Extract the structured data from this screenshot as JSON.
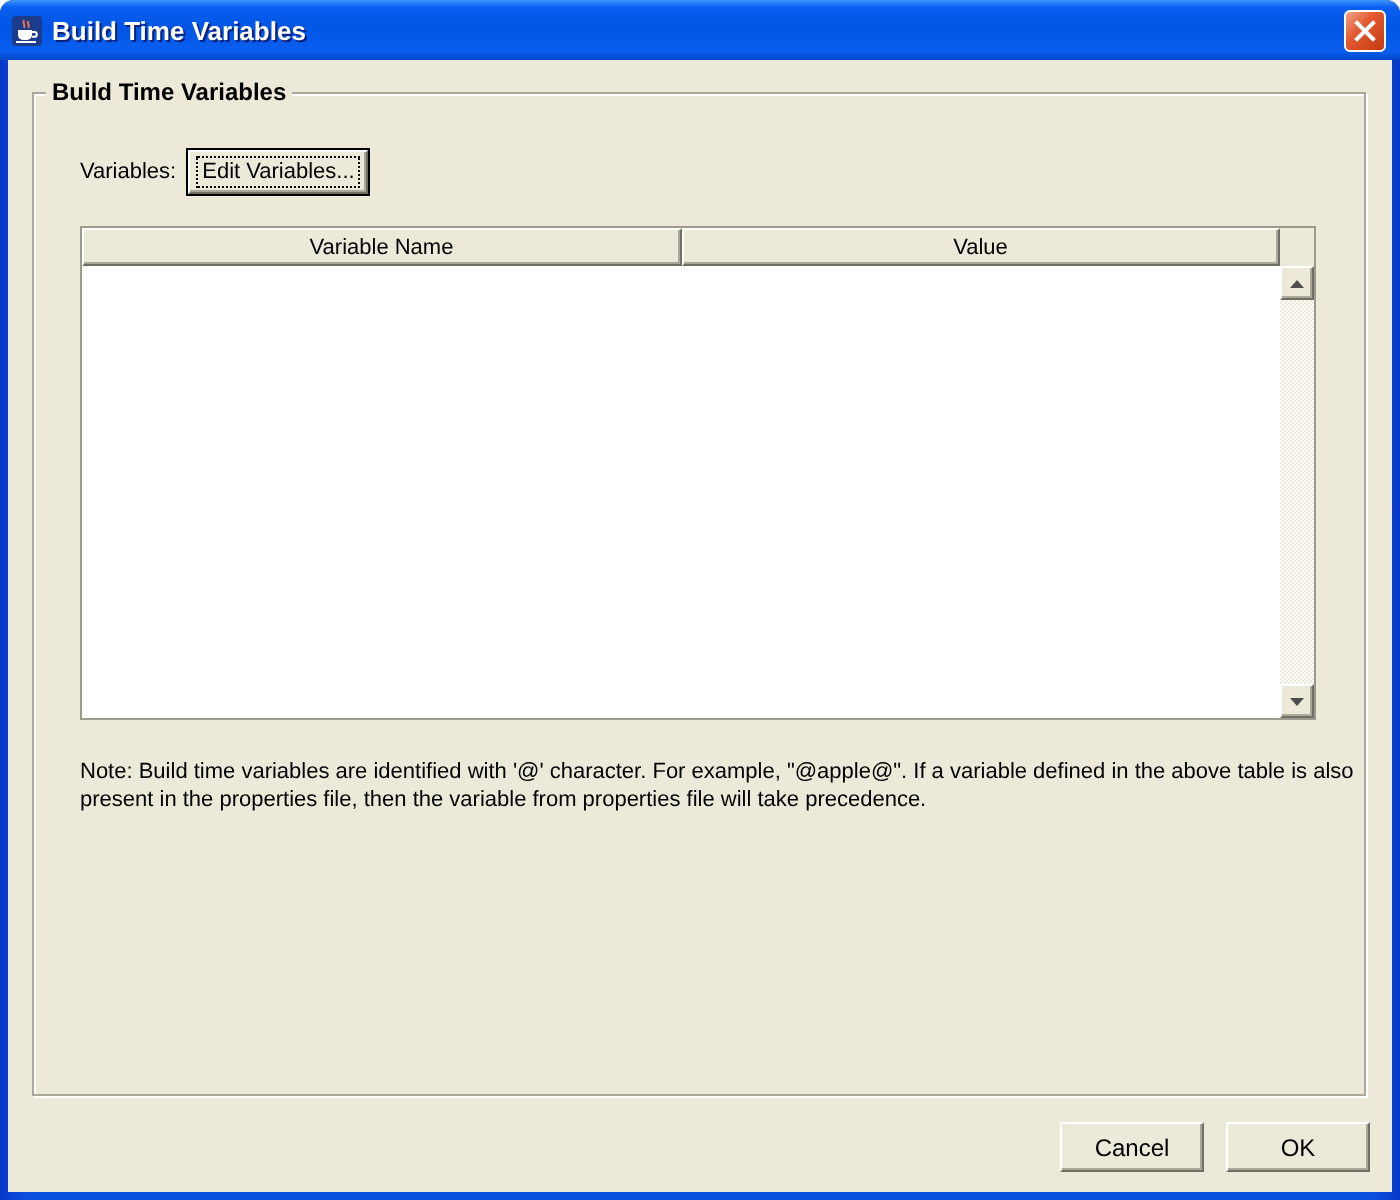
{
  "window": {
    "title": "Build Time Variables"
  },
  "group": {
    "title": "Build Time Variables",
    "variables_label": "Variables:",
    "edit_button": {
      "label": "Edit Variables...",
      "focused": true
    },
    "table": {
      "columns": [
        "Variable Name",
        "Value"
      ]
    },
    "note": "Note: Build time variables are identified with '@' character. For example, \"@apple@\". If a variable defined in the above table is also present in the properties file, then the variable from properties file will take precedence."
  },
  "buttons": [
    "Cancel",
    "OK"
  ]
}
